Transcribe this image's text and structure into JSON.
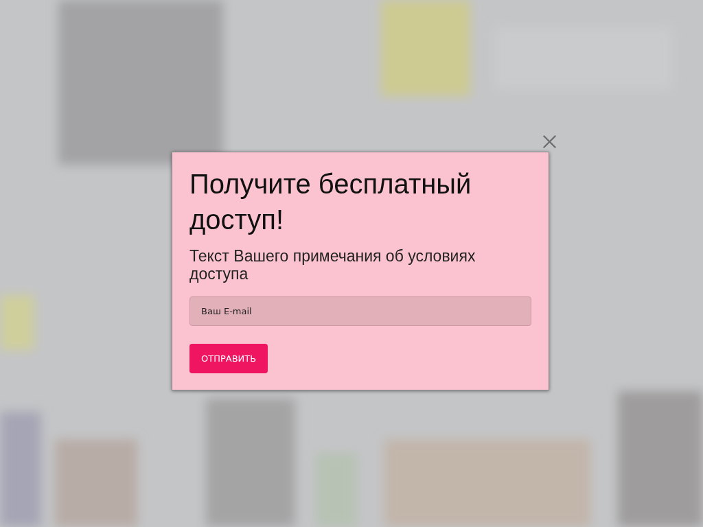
{
  "modal": {
    "title": "Получите бесплатный доступ!",
    "note": "Текст Вашего примечания об условиях доступа",
    "email_field": {
      "placeholder": "Ваш E-mail"
    },
    "submit_button": "ОТПРАВИТЬ"
  }
}
